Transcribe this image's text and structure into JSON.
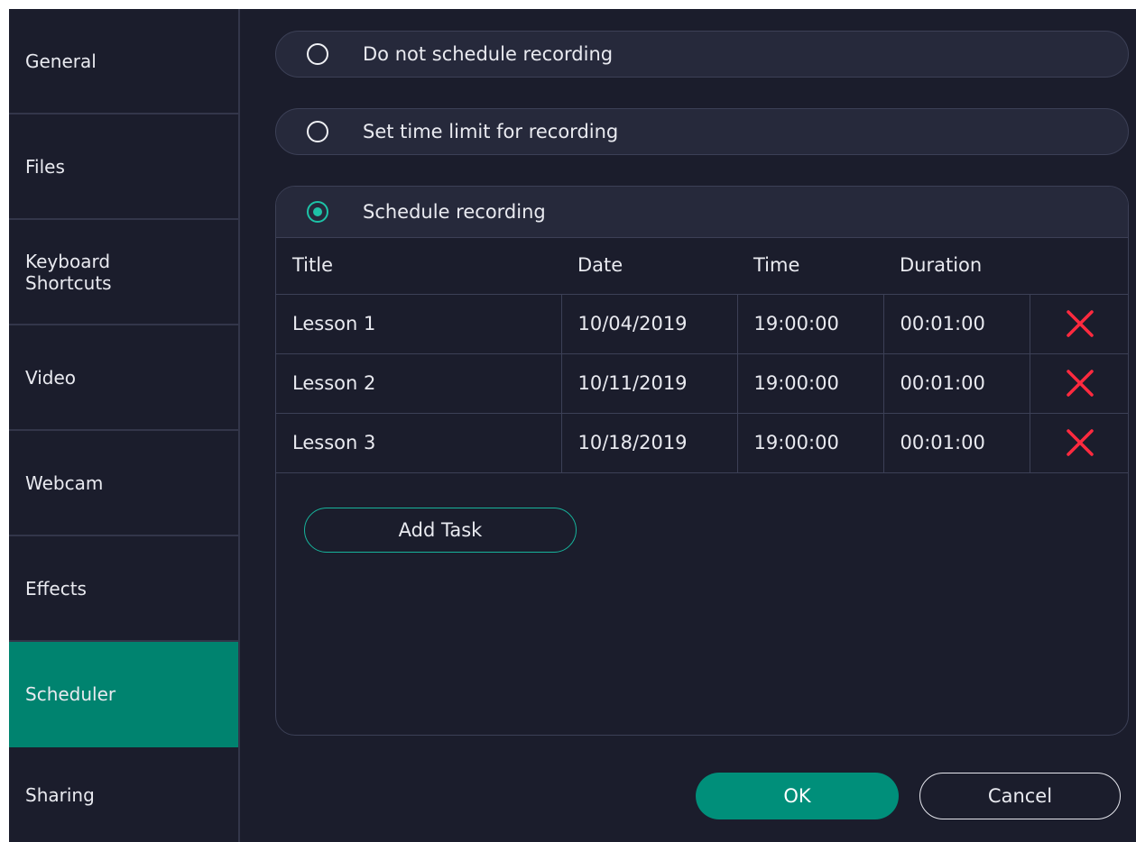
{
  "sidebar": {
    "items": [
      {
        "label": "General"
      },
      {
        "label": "Files"
      },
      {
        "label": "Keyboard\nShortcuts"
      },
      {
        "label": "Video"
      },
      {
        "label": "Webcam"
      },
      {
        "label": "Effects"
      },
      {
        "label": "Scheduler",
        "active": true
      },
      {
        "label": "Sharing"
      }
    ]
  },
  "options": {
    "no_schedule": "Do not schedule recording",
    "time_limit": "Set time limit for recording",
    "schedule": "Schedule recording",
    "selected": "schedule"
  },
  "table": {
    "headers": [
      "Title",
      "Date",
      "Time",
      "Duration"
    ],
    "rows": [
      {
        "title": "Lesson 1",
        "date": "10/04/2019",
        "time": "19:00:00",
        "duration": "00:01:00"
      },
      {
        "title": "Lesson 2",
        "date": "10/11/2019",
        "time": "19:00:00",
        "duration": "00:01:00"
      },
      {
        "title": "Lesson 3",
        "date": "10/18/2019",
        "time": "19:00:00",
        "duration": "00:01:00"
      }
    ]
  },
  "add_task_label": "Add Task",
  "footer": {
    "ok_label": "OK",
    "cancel_label": "Cancel"
  },
  "colors": {
    "accent": "#00836f",
    "background": "#1b1d2c",
    "delete": "#ff2a3f"
  },
  "icons": {
    "delete": "close-x-icon",
    "radio": "radio-button-icon"
  }
}
